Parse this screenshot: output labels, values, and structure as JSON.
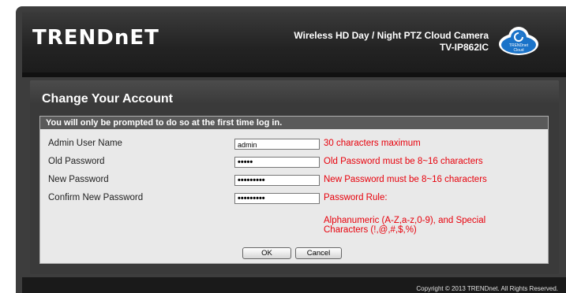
{
  "brand": {
    "logo": "TRENDnET"
  },
  "product": {
    "line1": "Wireless HD Day / Night PTZ Cloud Camera",
    "line2": "TV-IP862IC",
    "badge": "TRENDnet Cloud"
  },
  "panel": {
    "title": "Change Your Account",
    "notice": "You will only be prompted to do so at the first time log in."
  },
  "form": {
    "admin_label": "Admin User Name",
    "admin_value": "admin",
    "admin_hint": "30 characters maximum",
    "old_label": "Old Password",
    "old_value": "•••••",
    "old_hint": "Old Password must be 8~16 characters",
    "new_label": "New Password",
    "new_value": "•••••••••",
    "new_hint": "New Password must be 8~16 characters",
    "confirm_label": "Confirm New Password",
    "confirm_value": "•••••••••",
    "rule_title": "Password Rule:",
    "rule_line1": "Alphanumeric (A-Z,a-z,0-9), and Special",
    "rule_line2": "Characters (!,@,#,$,%)"
  },
  "buttons": {
    "ok": "OK",
    "cancel": "Cancel"
  },
  "footer": {
    "copyright": "Copyright © 2013 TRENDnet. All Rights Reserved."
  },
  "colors": {
    "hint": "#e8000b",
    "header": "#2a2a2a",
    "accent": "#1a73c9"
  }
}
